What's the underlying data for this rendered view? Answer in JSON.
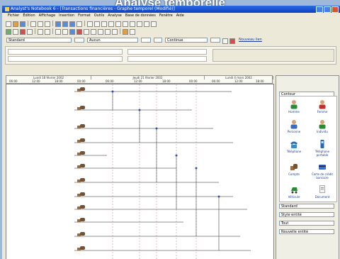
{
  "header": {
    "caption": "Analyse temporelle"
  },
  "window": {
    "title": "Analyst's Notebook 6 - [Transactions financières - Graphe temporel (Modifié)]"
  },
  "menu": [
    "Fichier",
    "Édition",
    "Affichage",
    "Insertion",
    "Format",
    "Outils",
    "Analyse",
    "Base de données",
    "Fenêtre",
    "Aide"
  ],
  "formatbar": {
    "font": "Standard",
    "style": "Aucun",
    "line_style": "Continue",
    "link": "Nouveau lien"
  },
  "timeline": {
    "bands": [
      "Lundi 18 février 2002",
      "Jeudi 21 février 2002",
      "Lundi 4 mars 2002"
    ],
    "ticks": [
      "06:00",
      "12:00",
      "18:00",
      "00:00",
      "06:00",
      "12:00",
      "18:00",
      "00:00",
      "06:00",
      "12:00",
      "18:00"
    ]
  },
  "gallery": {
    "category": "Contour",
    "items": [
      "Homme",
      "Femme",
      "Personne",
      "Individu",
      "Téléphone",
      "Téléphone portable",
      "Compte",
      "Carte de crédit bancaire",
      "Véhicule",
      "Document"
    ]
  },
  "properties": {
    "field1": "Standard",
    "field2": "Style entité",
    "field3": "Tout",
    "field4": "Nouvelle entité"
  }
}
